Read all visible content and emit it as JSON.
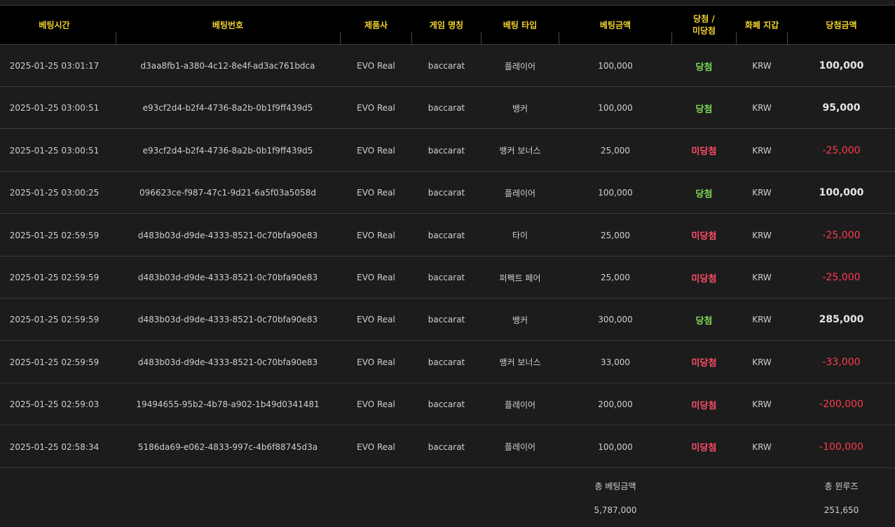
{
  "headers": [
    "베팅시간",
    "베팅번호",
    "제품사",
    "게임 명칭",
    "베팅 타입",
    "베팅금액",
    "당첨 /\n미당첨",
    "화폐 지갑",
    "당첨금액"
  ],
  "rows": [
    {
      "time": "2025-01-25 03:01:17",
      "id": "d3aa8fb1-a380-4c12-8e4f-ad3ac761bdca",
      "vendor": "EVO Real",
      "game": "baccarat",
      "type": "플레이어",
      "bet": "100,000",
      "result": "당첨",
      "result_kind": "win",
      "currency": "KRW",
      "payout": "100,000",
      "payout_kind": "pos"
    },
    {
      "time": "2025-01-25 03:00:51",
      "id": "e93cf2d4-b2f4-4736-8a2b-0b1f9ff439d5",
      "vendor": "EVO Real",
      "game": "baccarat",
      "type": "뱅커",
      "bet": "100,000",
      "result": "당첨",
      "result_kind": "win",
      "currency": "KRW",
      "payout": "95,000",
      "payout_kind": "pos"
    },
    {
      "time": "2025-01-25 03:00:51",
      "id": "e93cf2d4-b2f4-4736-8a2b-0b1f9ff439d5",
      "vendor": "EVO Real",
      "game": "baccarat",
      "type": "뱅커 보너스",
      "bet": "25,000",
      "result": "미당첨",
      "result_kind": "lose",
      "currency": "KRW",
      "payout": "-25,000",
      "payout_kind": "neg"
    },
    {
      "time": "2025-01-25 03:00:25",
      "id": "096623ce-f987-47c1-9d21-6a5f03a5058d",
      "vendor": "EVO Real",
      "game": "baccarat",
      "type": "플레이어",
      "bet": "100,000",
      "result": "당첨",
      "result_kind": "win",
      "currency": "KRW",
      "payout": "100,000",
      "payout_kind": "pos"
    },
    {
      "time": "2025-01-25 02:59:59",
      "id": "d483b03d-d9de-4333-8521-0c70bfa90e83",
      "vendor": "EVO Real",
      "game": "baccarat",
      "type": "타이",
      "bet": "25,000",
      "result": "미당첨",
      "result_kind": "lose",
      "currency": "KRW",
      "payout": "-25,000",
      "payout_kind": "neg"
    },
    {
      "time": "2025-01-25 02:59:59",
      "id": "d483b03d-d9de-4333-8521-0c70bfa90e83",
      "vendor": "EVO Real",
      "game": "baccarat",
      "type": "퍼펙트 페어",
      "bet": "25,000",
      "result": "미당첨",
      "result_kind": "lose",
      "currency": "KRW",
      "payout": "-25,000",
      "payout_kind": "neg"
    },
    {
      "time": "2025-01-25 02:59:59",
      "id": "d483b03d-d9de-4333-8521-0c70bfa90e83",
      "vendor": "EVO Real",
      "game": "baccarat",
      "type": "뱅커",
      "bet": "300,000",
      "result": "당첨",
      "result_kind": "win",
      "currency": "KRW",
      "payout": "285,000",
      "payout_kind": "pos"
    },
    {
      "time": "2025-01-25 02:59:59",
      "id": "d483b03d-d9de-4333-8521-0c70bfa90e83",
      "vendor": "EVO Real",
      "game": "baccarat",
      "type": "뱅커 보너스",
      "bet": "33,000",
      "result": "미당첨",
      "result_kind": "lose",
      "currency": "KRW",
      "payout": "-33,000",
      "payout_kind": "neg"
    },
    {
      "time": "2025-01-25 02:59:03",
      "id": "19494655-95b2-4b78-a902-1b49d0341481",
      "vendor": "EVO Real",
      "game": "baccarat",
      "type": "플레이어",
      "bet": "200,000",
      "result": "미당첨",
      "result_kind": "lose",
      "currency": "KRW",
      "payout": "-200,000",
      "payout_kind": "neg"
    },
    {
      "time": "2025-01-25 02:58:34",
      "id": "5186da69-e062-4833-997c-4b6f88745d3a",
      "vendor": "EVO Real",
      "game": "baccarat",
      "type": "플레이어",
      "bet": "100,000",
      "result": "미당첨",
      "result_kind": "lose",
      "currency": "KRW",
      "payout": "-100,000",
      "payout_kind": "neg"
    }
  ],
  "summary": {
    "total_bet_label": "총 베팅금액",
    "total_bet_value": "5,787,000",
    "total_winloss_label": "총 윈루즈",
    "total_winloss_value": "251,650"
  },
  "colors": {
    "header_text": "#f2d230",
    "win": "#7ed957",
    "lose": "#ff4d6a",
    "negative_amount": "#ff3b4e"
  }
}
